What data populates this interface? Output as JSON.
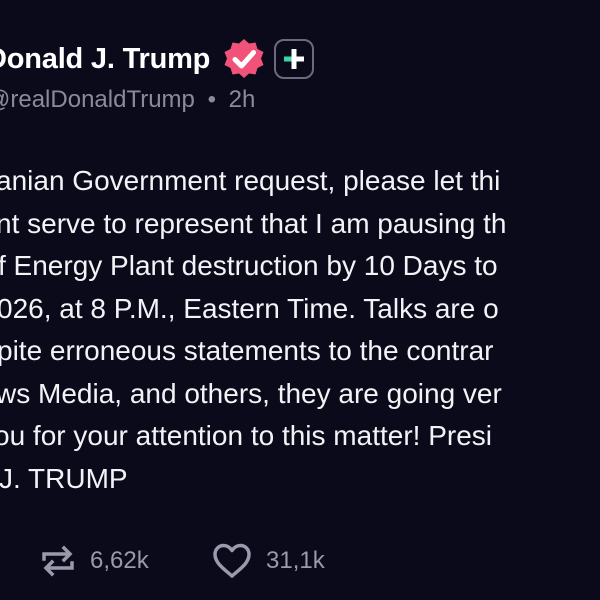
{
  "header": {
    "display_name": "Donald J. Trump",
    "handle": "@realDonaldTrump",
    "separator": "•",
    "time": "2h"
  },
  "post": {
    "lines": [
      "anian Government request, please let thi",
      "nt serve to represent that I am pausing th",
      "f Energy Plant destruction by 10 Days to",
      "026, at 8 P.M., Eastern Time. Talks are o",
      "pite erroneous statements to the contrar",
      "ws Media, and others, they are going ver",
      "ou for your attention to this matter! Presi",
      "J. TRUMP"
    ]
  },
  "actions": {
    "repost_count": "6,62k",
    "like_count": "31,1k"
  },
  "colors": {
    "background": "#0b0a1a",
    "verified_badge": "#f0527a",
    "text": "#f3f3f7",
    "muted": "#8b8a9c"
  },
  "icons": [
    "verified-badge-icon",
    "plus-icon",
    "repost-icon",
    "heart-icon"
  ]
}
